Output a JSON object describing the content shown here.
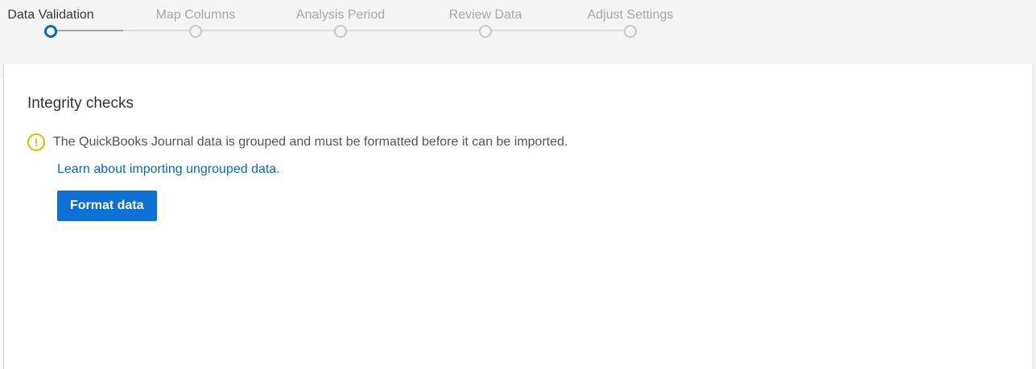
{
  "stepper": {
    "steps": [
      {
        "label": "Data Validation",
        "state": "active"
      },
      {
        "label": "Map Columns",
        "state": "pending"
      },
      {
        "label": "Analysis Period",
        "state": "pending"
      },
      {
        "label": "Review Data",
        "state": "pending"
      },
      {
        "label": "Adjust Settings",
        "state": "pending"
      }
    ]
  },
  "integrity": {
    "title": "Integrity checks",
    "warning_icon": "warning-circle-icon",
    "warning_text": "The QuickBooks Journal data is grouped and must be formatted before it can be imported.",
    "help_link": "Learn about importing ungrouped data.",
    "format_button": "Format data"
  },
  "colors": {
    "accent": "#0b66c3",
    "warning": "#e8b400",
    "active_step": "#0b66c3",
    "inactive_step": "#c9c9c9"
  }
}
